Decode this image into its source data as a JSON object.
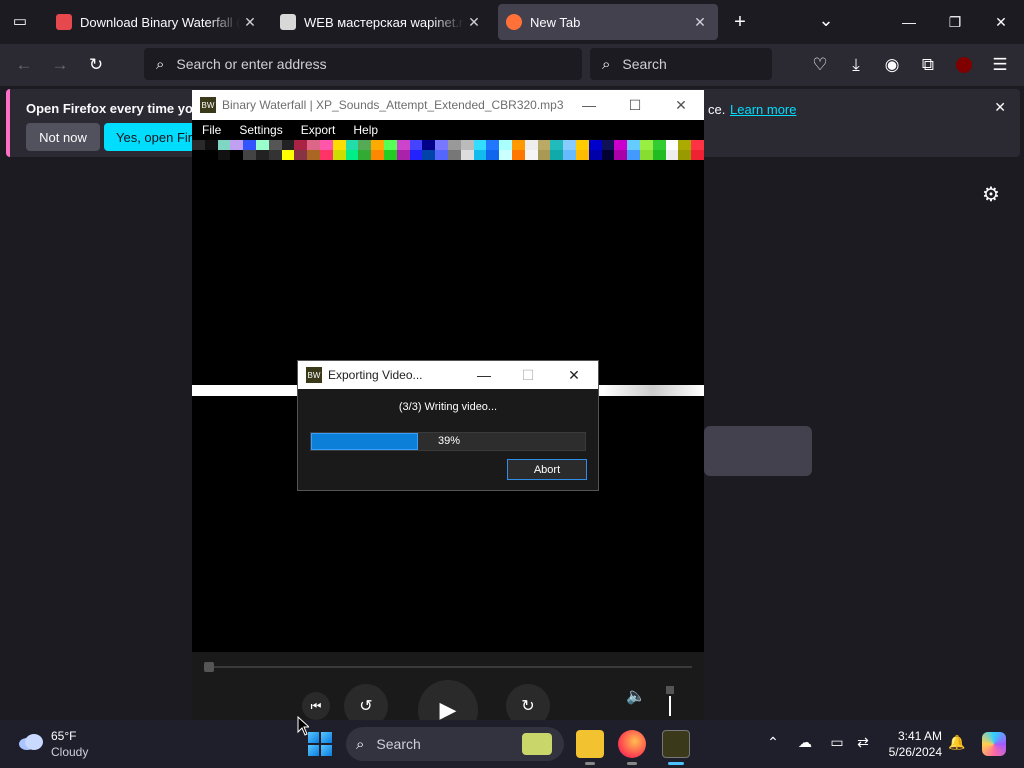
{
  "browser": {
    "tabs": [
      {
        "title": "Download Binary Waterfall (Wi",
        "favicon_color": "#e5484d",
        "active": false
      },
      {
        "title": "WEB мастерская wapinet.ru - ",
        "favicon_color": "#d8d8d8",
        "active": false
      },
      {
        "title": "New Tab",
        "favicon_color": "#ff7139",
        "active": true
      }
    ],
    "new_tab_glyph": "+",
    "tab_list_glyph": "⌄",
    "urlbar_placeholder": "Search or enter address",
    "searchbar_placeholder": "Search",
    "window_controls": {
      "minimize": "—",
      "restore": "❐",
      "close": "✕"
    }
  },
  "notification": {
    "message": "Open Firefox every time you re",
    "message_tail": "ce.",
    "learn_more": "Learn more",
    "not_now": "Not now",
    "yes_open": "Yes, open Firefox"
  },
  "app": {
    "title": "Binary Waterfall | XP_Sounds_Attempt_Extended_CBR320.mp3",
    "icon_text": "BW",
    "menu": [
      "File",
      "Settings",
      "Export",
      "Help"
    ],
    "pixel_colors": [
      "#2a2a2a",
      "#111",
      "#7fd6c2",
      "#c0a0f0",
      "#3355ff",
      "#99ffcc",
      "#555",
      "#222",
      "#aa2244",
      "#dd6688",
      "#ff55aa",
      "#ffdd00",
      "#22ddaa",
      "#55aa55",
      "#ffaa00",
      "#55ff55",
      "#cc44cc",
      "#4444ff",
      "#000088",
      "#7777ff",
      "#999",
      "#bbbbbb",
      "#33ddff",
      "#2277ff",
      "#aaffff",
      "#ff9900",
      "#eeeeee",
      "#bbaa66",
      "#22bbbb",
      "#88ccff",
      "#ffcc00",
      "#0000cc",
      "#111155",
      "#cc00cc",
      "#66ccff",
      "#99ee44",
      "#33cc33",
      "#ffffff",
      "#aaaa00",
      "#ff3344"
    ],
    "pixel_colors_row2": [
      "#000",
      "#000",
      "#111",
      "#000",
      "#444",
      "#222",
      "#333",
      "#ffff00",
      "#883344",
      "#aa6622",
      "#ff3366",
      "#ccdd00",
      "#00ee88",
      "#33aa33",
      "#ff8800",
      "#22cc22",
      "#aa22aa",
      "#2222ff",
      "#0044aa",
      "#5566ff",
      "#777",
      "#ddd",
      "#11bbee",
      "#1166ee",
      "#ccffff",
      "#ff7700",
      "#f5f5f5",
      "#aa9955",
      "#11aaaa",
      "#66bbff",
      "#ffbb00",
      "#0000aa",
      "#000033",
      "#aa00aa",
      "#4499ff",
      "#88dd33",
      "#22bb22",
      "#eeeeee",
      "#999900",
      "#ee2233"
    ]
  },
  "export_dialog": {
    "title": "Exporting Video...",
    "status": "(3/3) Writing video...",
    "progress": 39,
    "progress_label": "39%",
    "abort_label": "Abort"
  },
  "taskbar": {
    "weather_temp": "65°F",
    "weather_desc": "Cloudy",
    "search_placeholder": "Search",
    "time": "3:41 AM",
    "date": "5/26/2024"
  }
}
